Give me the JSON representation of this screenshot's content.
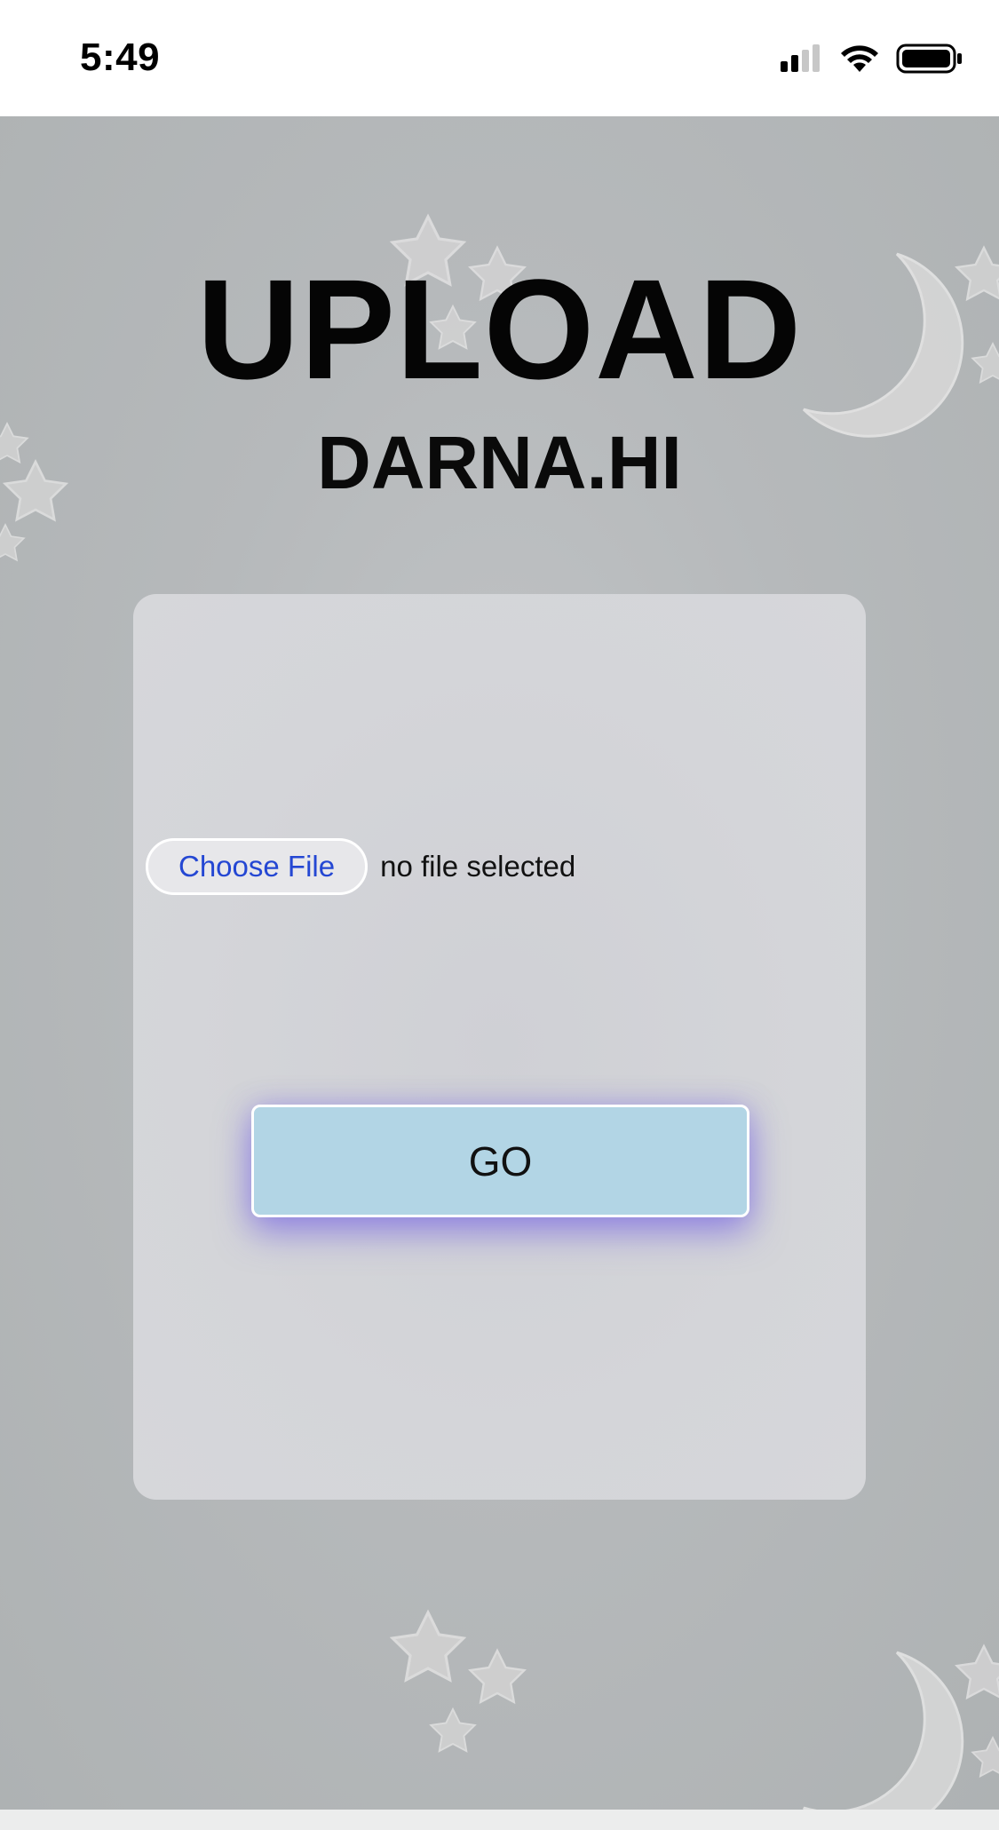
{
  "status_bar": {
    "time": "5:49",
    "icons": [
      "signal-icon",
      "wifi-icon",
      "battery-icon"
    ]
  },
  "page": {
    "title": "UPLOAD",
    "subtitle": "DARNA.HI"
  },
  "upload_form": {
    "choose_file_label": "Choose File",
    "file_status": "no file selected",
    "submit_label": "GO"
  },
  "colors": {
    "background": "#b1b5b6",
    "card": "#d4d5d9",
    "go_button": "#b2d5e5",
    "go_glow": "#6e5ae6",
    "choose_file_text": "#2447d3"
  },
  "decorations": [
    "star-icon",
    "moon-icon"
  ]
}
